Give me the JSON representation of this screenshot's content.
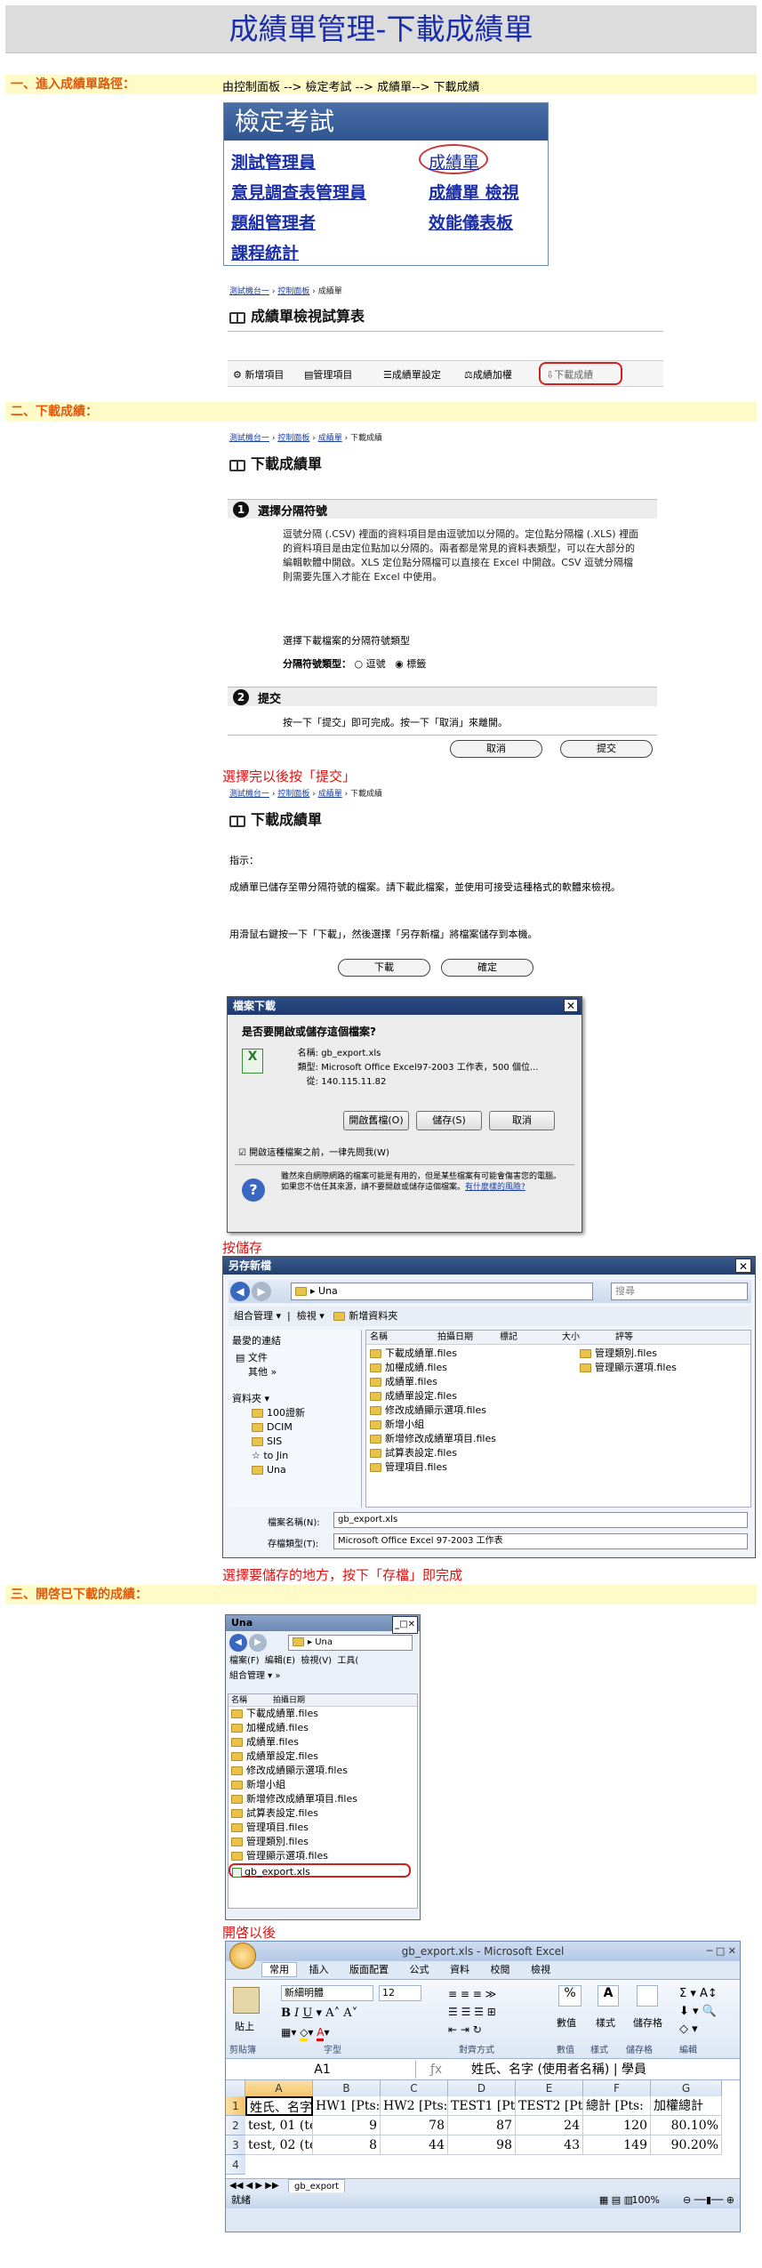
{
  "title": "成績單管理-下載成績單",
  "s1": {
    "label": "一、進入成績單路徑：",
    "path": "由控制面板 --> 檢定考試 --> 成績單--> 下載成績"
  },
  "panel1": {
    "header": "檢定考試",
    "items": [
      "測試管理員",
      "成績單",
      "意見調查表管理員",
      "成績單 檢視",
      "題組管理者",
      "效能儀表板",
      "課程統計"
    ]
  },
  "screen1": {
    "crumb": [
      "測試機台一",
      "控制面板",
      "成績單"
    ],
    "heading": "成績單檢視試算表",
    "toolbar": [
      "新增項目",
      "管理項目",
      "成績單設定",
      "成績加權",
      "下載成績"
    ]
  },
  "s2": {
    "label": "二、下載成績："
  },
  "screen2": {
    "crumb": [
      "測試機台一",
      "控制面板",
      "成績單",
      "下載成績"
    ],
    "heading": "下載成績單",
    "step1": "選擇分隔符號",
    "step1_num": "1",
    "desc": "逗號分隔 (.CSV) 裡面的資料項目是由逗號加以分隔的。定位點分隔檔 (.XLS) 裡面的資料項目是由定位點加以分隔的。兩者都是常見的資料表類型，可以在大部分的編輯軟體中開啟。XLS 定位點分隔檔可以直接在 Excel 中開啟。CSV 逗號分隔檔則需要先匯入才能在 Excel 中使用。",
    "choose": "選擇下載檔案的分隔符號類型",
    "delim_label": "分隔符號類型：",
    "opt1": "逗號",
    "opt2": "標籤",
    "step2": "提交",
    "step2_num": "2",
    "submit_text": "按一下「提交」即可完成。按一下「取消」來離開。",
    "cancel": "取消",
    "submit": "提交"
  },
  "note1": "選擇完以後按「提交」",
  "screen3": {
    "crumb": [
      "測試機台一",
      "控制面板",
      "成績單",
      "下載成績"
    ],
    "heading": "下載成績單",
    "hint": "指示：",
    "p1": "成績單已儲存至帶分隔符號的檔案。請下載此檔案，並使用可接受這種格式的軟體來檢視。",
    "p2": "用滑鼠右鍵按一下「下載」，然後選擇「另存新檔」將檔案儲存到本機。",
    "download": "下載",
    "ok": "確定"
  },
  "dialog": {
    "title": "檔案下載",
    "question": "是否要開啟或儲存這個檔案?",
    "name_label": "名稱:",
    "name": "gb_export.xls",
    "type_label": "類型:",
    "type": "Microsoft Office Excel97-2003 工作表，500 個位...",
    "from_label": "從:",
    "from": "140.115.11.82",
    "open": "開啟舊檔(O)",
    "save": "儲存(S)",
    "cancel": "取消",
    "always": "開啟這種檔案之前，一律先問我(W)",
    "warn": "雖然來自網際網路的檔案可能是有用的，但是某些檔案有可能會傷害您的電腦。如果您不信任其來源，請不要開啟或儲存這個檔案。",
    "warn_link": "有什麼樣的風險?"
  },
  "note2": "按儲存",
  "saveas": {
    "title": "另存新檔",
    "location": "Una",
    "search_placeholder": "搜尋",
    "org": "組合管理",
    "view": "檢視",
    "newfolder": "新增資料夾",
    "fav_label": "最愛的連結",
    "fav": [
      "文件",
      "其他 »"
    ],
    "tree_label": "資料夾",
    "tree": [
      "100證新",
      "DCIM",
      "SIS",
      "to Jin",
      "Una"
    ],
    "cols": [
      "名稱",
      "拍攝日期",
      "標記",
      "大小",
      "評等"
    ],
    "files_a": [
      "下載成績單.files",
      "加權成績.files",
      "成績單.files",
      "成績單設定.files",
      "修改成績顯示選項.files",
      "新增小組",
      "新增修改成績單項目.files",
      "試算表設定.files",
      "管理項目.files"
    ],
    "files_b": [
      "管理類別.files",
      "管理顯示選項.files"
    ],
    "fname_label": "檔案名稱(N):",
    "fname": "gb_export.xls",
    "ftype_label": "存檔類型(T):",
    "ftype": "Microsoft Office Excel 97-2003 工作表"
  },
  "note3": "選擇要儲存的地方，按下「存檔」即完成",
  "s3": {
    "label": "三、開啓已下載的成績："
  },
  "explorer": {
    "title": "Una",
    "location": "Una",
    "menu": [
      "檔案(F)",
      "編輯(E)",
      "檢視(V)",
      "工具("
    ],
    "org": "組合管理",
    "cols": [
      "名稱",
      "拍攝日期"
    ],
    "files": [
      "下載成績單.files",
      "加權成績.files",
      "成績單.files",
      "成績單設定.files",
      "修改成績顯示選項.files",
      "新增小組",
      "新增修改成績單項目.files",
      "試算表設定.files",
      "管理項目.files",
      "管理類別.files",
      "管理顯示選項.files",
      "gb_export.xls"
    ]
  },
  "note4": "開啓以後",
  "excel": {
    "title": "gb_export.xls - Microsoft Excel",
    "tabs": [
      "常用",
      "插入",
      "版面配置",
      "公式",
      "資料",
      "校閱",
      "檢視"
    ],
    "font": "新細明體",
    "size": "12",
    "groups": [
      "剪貼簿",
      "字型",
      "對齊方式",
      "數值",
      "樣式",
      "儲存格",
      "編輯"
    ],
    "paste": "貼上",
    "number_btn": "數值",
    "style_btn": "樣式",
    "cell_btn": "儲存格",
    "namebox": "A1",
    "formula": "姓氏、名字 (使用者名稱) | 學員",
    "cols": [
      "A",
      "B",
      "C",
      "D",
      "E",
      "F",
      "G"
    ],
    "rows": [
      [
        "姓氏、名字",
        "HW1 [Pts:",
        "HW2 [Pts:",
        "TEST1 [Pts",
        "TEST2 [Pts",
        "總計 [Pts:",
        "加權總計"
      ],
      [
        "test, 01 (tes",
        "9",
        "78",
        "87",
        "24",
        "120",
        "80.10%"
      ],
      [
        "test, 02 (tes",
        "8",
        "44",
        "98",
        "43",
        "149",
        "90.20%"
      ]
    ],
    "sheet": "gb_export",
    "zoom": "100%",
    "status": "就緒"
  }
}
